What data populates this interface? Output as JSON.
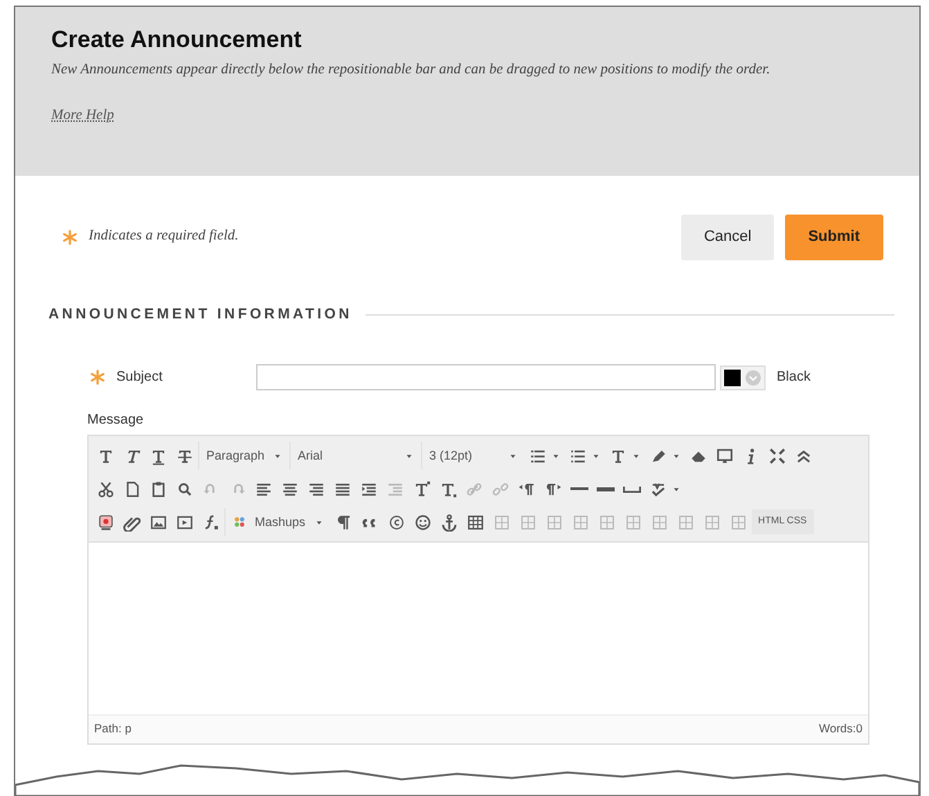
{
  "header": {
    "title": "Create Announcement",
    "description": "New Announcements appear directly below the repositionable bar and can be dragged to new positions to modify the order.",
    "help_link": "More Help"
  },
  "required_note": "Indicates a required field.",
  "buttons": [
    {
      "label": "Cancel",
      "kind": "secondary"
    },
    {
      "label": "Submit",
      "kind": "primary"
    }
  ],
  "section": {
    "title": "ANNOUNCEMENT INFORMATION"
  },
  "subject": {
    "label": "Subject",
    "required": true,
    "color_name": "Black",
    "color": "#000000"
  },
  "message": {
    "label": "Message",
    "toolbar": [
      [
        {
          "kind": "button",
          "disabled": false
        },
        {
          "kind": "button",
          "disabled": false
        },
        {
          "kind": "button",
          "disabled": false
        },
        {
          "kind": "button",
          "disabled": false
        },
        {
          "kind": "dropdown",
          "label": "Paragraph"
        },
        {
          "kind": "dropdown",
          "label": "Arial"
        },
        {
          "kind": "dropdown",
          "label": "3 (12pt)"
        },
        {
          "kind": "split",
          "disabled": false
        },
        {
          "kind": "split",
          "disabled": false
        },
        {
          "kind": "split",
          "disabled": false
        },
        {
          "kind": "split",
          "disabled": false
        },
        {
          "kind": "button",
          "disabled": false
        },
        {
          "kind": "button",
          "disabled": false
        },
        {
          "kind": "button",
          "disabled": false
        },
        {
          "kind": "button",
          "disabled": false
        },
        {
          "kind": "button",
          "disabled": false
        }
      ],
      [
        {
          "kind": "button",
          "disabled": false
        },
        {
          "kind": "button",
          "disabled": false
        },
        {
          "kind": "button",
          "disabled": false
        },
        {
          "kind": "button",
          "disabled": false
        },
        {
          "kind": "button",
          "disabled": true
        },
        {
          "kind": "button",
          "disabled": true
        },
        {
          "kind": "button",
          "disabled": false
        },
        {
          "kind": "button",
          "disabled": false
        },
        {
          "kind": "button",
          "disabled": false
        },
        {
          "kind": "button",
          "disabled": false
        },
        {
          "kind": "button",
          "disabled": false
        },
        {
          "kind": "button",
          "disabled": true
        },
        {
          "kind": "button",
          "disabled": false
        },
        {
          "kind": "button",
          "disabled": false
        },
        {
          "kind": "button",
          "disabled": true
        },
        {
          "kind": "button",
          "disabled": true
        },
        {
          "kind": "button",
          "disabled": false
        },
        {
          "kind": "button",
          "disabled": false
        },
        {
          "kind": "button",
          "disabled": false
        },
        {
          "kind": "button",
          "disabled": false
        },
        {
          "kind": "button",
          "disabled": false
        },
        {
          "kind": "split",
          "disabled": false
        }
      ],
      [
        {
          "kind": "button",
          "disabled": false
        },
        {
          "kind": "button",
          "disabled": false
        },
        {
          "kind": "button",
          "disabled": false
        },
        {
          "kind": "button",
          "disabled": false
        },
        {
          "kind": "button",
          "disabled": false
        },
        {
          "kind": "dropdown",
          "label": "Mashups"
        },
        {
          "kind": "button",
          "disabled": false
        },
        {
          "kind": "button",
          "disabled": false
        },
        {
          "kind": "button",
          "disabled": false
        },
        {
          "kind": "button",
          "disabled": false
        },
        {
          "kind": "button",
          "disabled": false
        },
        {
          "kind": "button",
          "disabled": false
        },
        {
          "kind": "button",
          "disabled": true
        },
        {
          "kind": "button",
          "disabled": true
        },
        {
          "kind": "button",
          "disabled": true
        },
        {
          "kind": "button",
          "disabled": true
        },
        {
          "kind": "button",
          "disabled": true
        },
        {
          "kind": "button",
          "disabled": true
        },
        {
          "kind": "button",
          "disabled": true
        },
        {
          "kind": "button",
          "disabled": true
        },
        {
          "kind": "button",
          "disabled": true
        },
        {
          "kind": "button",
          "disabled": true
        },
        {
          "kind": "textbutton",
          "label": "HTML CSS",
          "disabled": false
        }
      ]
    ],
    "path": "Path: p",
    "word_count": "Words:0"
  }
}
